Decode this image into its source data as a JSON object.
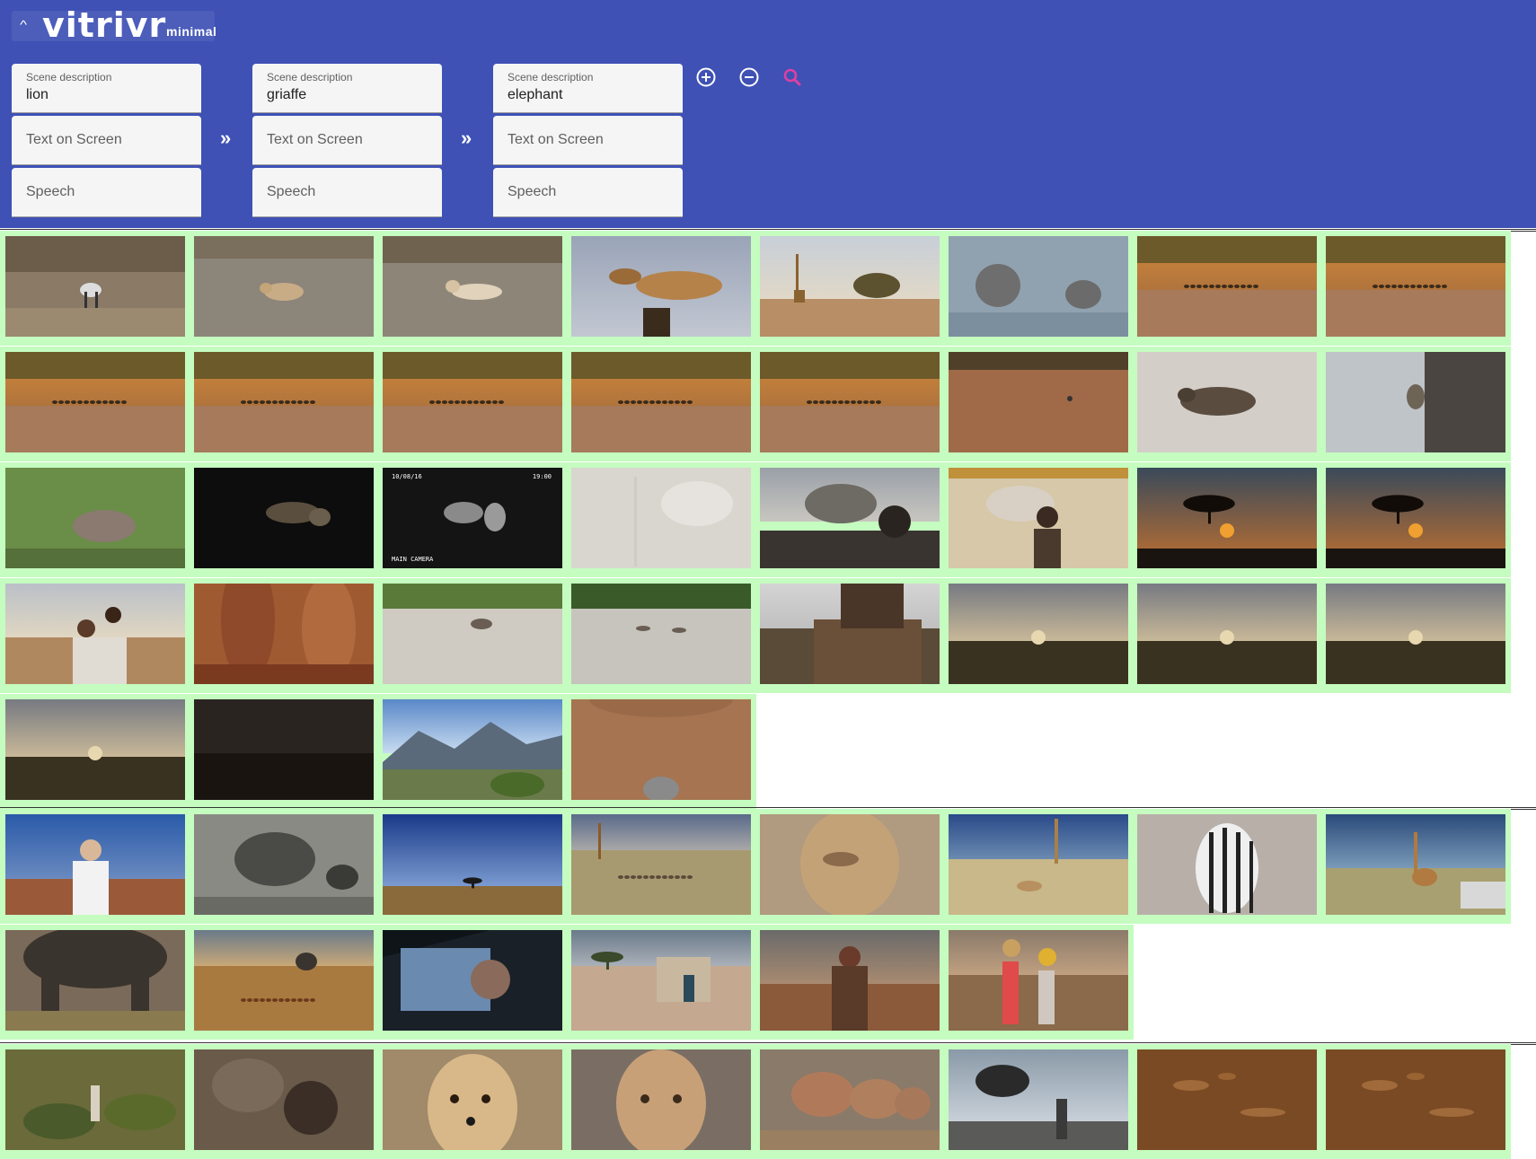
{
  "header": {
    "logo_text": "vitrivr",
    "logo_sub": "minimal",
    "collapse_icon": "chevron-up-icon"
  },
  "query": {
    "stages": [
      {
        "scene_label": "Scene description",
        "scene_value": "lion",
        "text_placeholder": "Text on Screen",
        "speech_placeholder": "Speech"
      },
      {
        "scene_label": "Scene description",
        "scene_value": "griaffe",
        "text_placeholder": "Text on Screen",
        "speech_placeholder": "Speech"
      },
      {
        "scene_label": "Scene description",
        "scene_value": "elephant",
        "text_placeholder": "Text on Screen",
        "speech_placeholder": "Speech"
      }
    ],
    "stage_arrow": "»",
    "add_icon": "add-circle-icon",
    "remove_icon": "remove-circle-icon",
    "search_icon": "search-icon",
    "search_color": "#e040a0"
  },
  "colors": {
    "header_bg": "#3f51b5",
    "tile_highlight": "#c5fcc0",
    "separator": "#333333"
  },
  "results": [
    {
      "rows": [
        {
          "tiles": [
            "savanna-zebra",
            "lioness-resting",
            "lioness-lying",
            "giraffe-closeup",
            "giraffe-tree",
            "elephants-water",
            "dusty-herd",
            "dusty-herd"
          ]
        },
        {
          "tiles": [
            "dusty-herd",
            "dusty-herd",
            "dusty-herd",
            "dusty-herd",
            "dusty-herd",
            "dry-plain",
            "hyena-sand",
            "baboon-tree"
          ]
        },
        {
          "tiles": [
            "elephant-mud",
            "night-animals",
            "night-lion-cam",
            "elephant-statue-faded",
            "elephant-people",
            "elephant-statue-woman",
            "sunset-tree",
            "sunset-tree"
          ]
        },
        {
          "tiles": [
            "family-savanna",
            "feet-closeup",
            "hippo-river",
            "hippo-river-wide",
            "wooden-walkway",
            "cloudy-savanna",
            "cloudy-savanna",
            "cloudy-savanna"
          ]
        },
        {
          "tiles": [
            "cloudy-savanna",
            "dark-savanna",
            "mountain-landscape",
            "dirt-ground"
          ]
        }
      ]
    },
    {
      "rows": [
        {
          "tiles": [
            "woman-blue-sky",
            "elephant-calf",
            "blue-sky-plain",
            "savanna-herds",
            "lion-face",
            "giraffe-lion",
            "zebra-closeup",
            "giraffe-road"
          ]
        },
        {
          "tiles": [
            "elephant-legs",
            "antelope-elephant",
            "car-driver",
            "village-building",
            "himba-woman",
            "women-water-jugs"
          ]
        }
      ]
    },
    {
      "rows": [
        {
          "tiles": [
            "meerkat-grass",
            "elephant-skin",
            "cheetah-face",
            "lioness-face",
            "elephant-group",
            "elephant-airlift",
            "rock-art",
            "rock-art"
          ]
        }
      ]
    }
  ],
  "captions": {
    "cam_date": "10/08/16",
    "cam_time": "19:00",
    "cam_label": "MAIN CAMERA"
  }
}
